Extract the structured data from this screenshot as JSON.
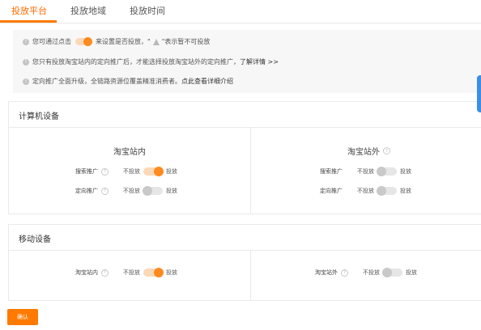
{
  "tabs": [
    {
      "label": "投放平台",
      "active": true
    },
    {
      "label": "投放地域",
      "active": false
    },
    {
      "label": "投放时间",
      "active": false
    }
  ],
  "notice": {
    "line1_prefix": "您可通过点击",
    "line1_mid": "来设置是否投放，\"",
    "line1_suffix": "\"表示暂不可投放",
    "line2_text": "您只有投放淘宝站内的定向推广后，才能选择投放淘宝站外的定向推广，",
    "line2_link": "了解详情 >>",
    "line3_text": "定向推广全面升级，全链路资源位覆盖精准消费者。",
    "line3_link": "点此查看详细介绍"
  },
  "computer": {
    "title": "计算机设备",
    "inside": {
      "title": "淘宝站内",
      "rows": [
        {
          "label": "搜索推广",
          "off": "不投放",
          "on": "投放",
          "enabled": true
        },
        {
          "label": "定向推广",
          "off": "不投放",
          "on": "投放",
          "enabled": false
        }
      ]
    },
    "outside": {
      "title": "淘宝站外",
      "rows": [
        {
          "label": "搜索推广",
          "off": "不投放",
          "on": "投放",
          "enabled": false
        },
        {
          "label": "定向推广",
          "off": "不投放",
          "on": "投放",
          "enabled": false
        }
      ]
    }
  },
  "mobile": {
    "title": "移动设备",
    "inside": {
      "label": "淘宝站内",
      "off": "不投放",
      "on": "投放",
      "enabled": true
    },
    "outside": {
      "label": "淘宝站外",
      "off": "不投放",
      "on": "投放",
      "enabled": false
    }
  },
  "confirm_label": "确认",
  "colors": {
    "accent": "#ff7a00",
    "side_tab": "#3a8ee6"
  },
  "icons": {
    "info": "info-icon",
    "question": "question-icon",
    "warning": "warning-icon"
  }
}
